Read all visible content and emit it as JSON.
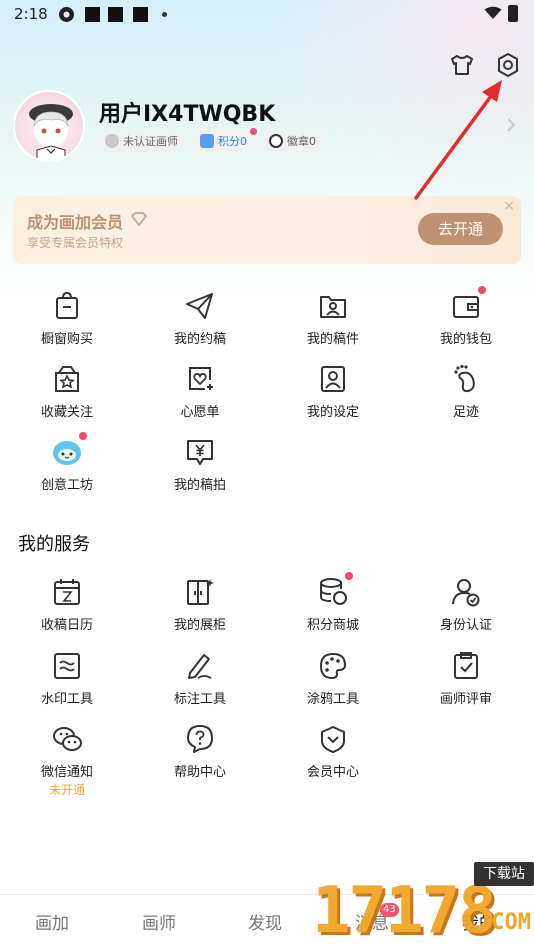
{
  "status_bar": {
    "time": "2:18"
  },
  "profile": {
    "username": "用户IX4TWQBK",
    "tags": {
      "certify": "未认证画师",
      "points": "积分0",
      "badges": "徽章0"
    }
  },
  "vip_banner": {
    "title": "成为画加会员",
    "subtitle": "享受专属会员特权",
    "button": "去开通",
    "close": "×"
  },
  "grid_main": [
    {
      "label": "橱窗购买",
      "icon": "shopping-bag-icon"
    },
    {
      "label": "我的约稿",
      "icon": "paper-plane-icon"
    },
    {
      "label": "我的稿件",
      "icon": "folder-user-icon"
    },
    {
      "label": "我的钱包",
      "icon": "wallet-icon"
    },
    {
      "label": "收藏关注",
      "icon": "star-box-icon"
    },
    {
      "label": "心愿单",
      "icon": "heart-list-icon"
    },
    {
      "label": "我的设定",
      "icon": "profile-card-icon"
    },
    {
      "label": "足迹",
      "icon": "footprint-icon"
    },
    {
      "label": "创意工坊",
      "icon": "workshop-mascot-icon"
    },
    {
      "label": "我的稿拍",
      "icon": "yen-note-icon"
    }
  ],
  "services": {
    "title": "我的服务",
    "items": [
      {
        "label": "收稿日历",
        "icon": "calendar-icon"
      },
      {
        "label": "我的展柜",
        "icon": "showcase-icon"
      },
      {
        "label": "积分商城",
        "icon": "coins-stack-icon"
      },
      {
        "label": "身份认证",
        "icon": "user-verify-icon"
      },
      {
        "label": "水印工具",
        "icon": "watermark-icon"
      },
      {
        "label": "标注工具",
        "icon": "pen-icon"
      },
      {
        "label": "涂鸦工具",
        "icon": "palette-icon"
      },
      {
        "label": "画师评审",
        "icon": "clipboard-check-icon"
      },
      {
        "label": "微信通知",
        "icon": "wechat-icon",
        "sub": "未开通"
      },
      {
        "label": "帮助中心",
        "icon": "help-icon"
      },
      {
        "label": "会员中心",
        "icon": "vip-icon"
      }
    ]
  },
  "bottom_nav": {
    "items": [
      "画加",
      "画师",
      "发现",
      "消息",
      "我的"
    ],
    "badge": "43"
  },
  "watermark": {
    "digits": "17178",
    "label": "下载站",
    "suffix": ".COM"
  }
}
